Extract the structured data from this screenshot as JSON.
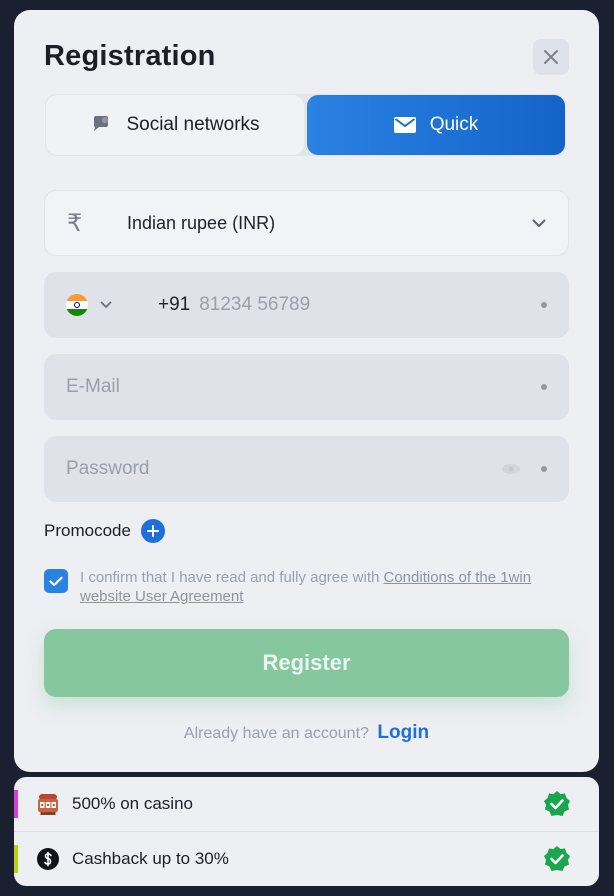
{
  "modal": {
    "title": "Registration",
    "tabs": [
      {
        "label": "Social networks",
        "icon": "chat-bubble-icon",
        "active": false
      },
      {
        "label": "Quick",
        "icon": "envelope-icon",
        "active": true
      }
    ],
    "currency": {
      "symbol": "₹",
      "value": "Indian rupee (INR)"
    },
    "phone": {
      "country_code": "+91",
      "placeholder": "81234 56789",
      "flag": "india-flag-icon"
    },
    "email": {
      "placeholder": "E-Mail"
    },
    "password": {
      "placeholder": "Password"
    },
    "promocode_label": "Promocode",
    "agreement": {
      "checked": true,
      "text": "I confirm that I have read and fully agree with ",
      "link": "Conditions of the 1win website User Agreement"
    },
    "register_label": "Register",
    "login_prompt": "Already have an account?",
    "login_link": "Login"
  },
  "bonuses": [
    {
      "text": "500% on casino",
      "icon": "slot-machine-icon",
      "stripe_color": "#d63ed8"
    },
    {
      "text": "Cashback up to 30%",
      "icon": "cashback-icon",
      "stripe_color": "#b8d40f"
    }
  ],
  "colors": {
    "accent": "#1e6fd9",
    "register_disabled": "#86c79f",
    "check_badge": "#1aa64e"
  }
}
